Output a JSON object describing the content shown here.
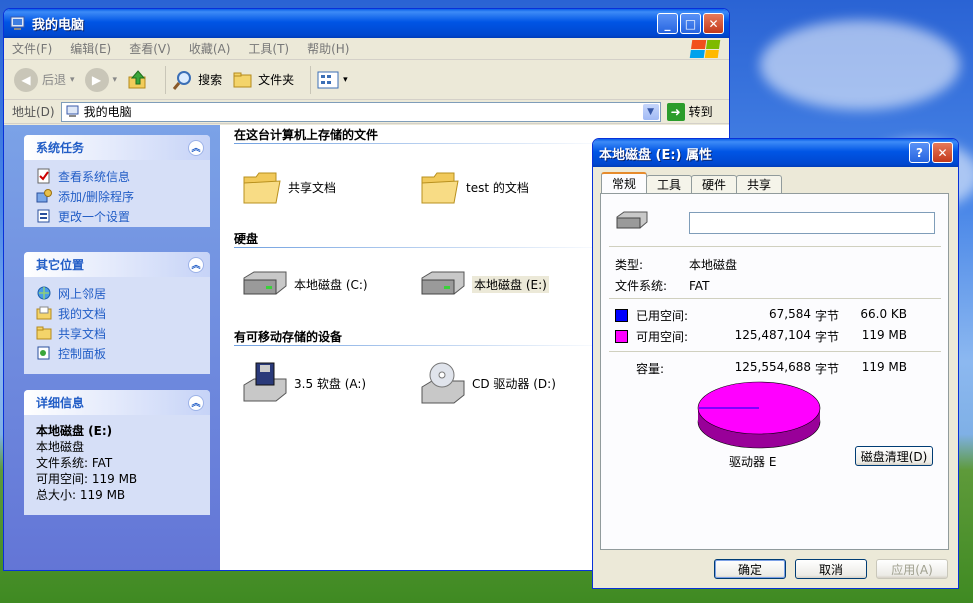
{
  "explorer": {
    "title": "我的电脑",
    "menu": [
      "文件(F)",
      "编辑(E)",
      "查看(V)",
      "收藏(A)",
      "工具(T)",
      "帮助(H)"
    ],
    "toolbar": {
      "back": "后退",
      "search": "搜索",
      "folders": "文件夹"
    },
    "address": {
      "label": "地址(D)",
      "value": "我的电脑",
      "go": "转到"
    }
  },
  "leftpane": {
    "system_tasks": {
      "title": "系统任务",
      "items": [
        "查看系统信息",
        "添加/删除程序",
        "更改一个设置"
      ]
    },
    "other_places": {
      "title": "其它位置",
      "items": [
        "网上邻居",
        "我的文档",
        "共享文档",
        "控制面板"
      ]
    },
    "details": {
      "title": "详细信息",
      "name": "本地磁盘 (E:)",
      "type": "本地磁盘",
      "fs": "文件系统: FAT",
      "free": "可用空间: 119 MB",
      "total": "总大小: 119 MB"
    }
  },
  "main": {
    "group_files": "在这台计算机上存储的文件",
    "shared_docs": "共享文档",
    "test_docs": "test 的文档",
    "group_hdd": "硬盘",
    "drive_c": "本地磁盘 (C:)",
    "drive_e": "本地磁盘 (E:)",
    "group_removable": "有可移动存储的设备",
    "floppy": "3.5 软盘 (A:)",
    "cd": "CD 驱动器 (D:)"
  },
  "dialog": {
    "title": "本地磁盘 (E:) 属性",
    "tabs": [
      "常规",
      "工具",
      "硬件",
      "共享"
    ],
    "label_value": "",
    "type_label": "类型:",
    "type_value": "本地磁盘",
    "fs_label": "文件系统:",
    "fs_value": "FAT",
    "used_label": "已用空间:",
    "used_bytes": "67,584",
    "used_unit": "字节",
    "used_human": "66.0 KB",
    "free_label": "可用空间:",
    "free_bytes": "125,487,104",
    "free_unit": "字节",
    "free_human": "119 MB",
    "cap_label": "容量:",
    "cap_bytes": "125,554,688",
    "cap_unit": "字节",
    "cap_human": "119 MB",
    "drive_caption": "驱动器 E",
    "cleanup": "磁盘清理(D)",
    "ok": "确定",
    "cancel": "取消",
    "apply": "应用(A)",
    "used_color": "#0000ff",
    "free_color": "#ff00ff"
  }
}
